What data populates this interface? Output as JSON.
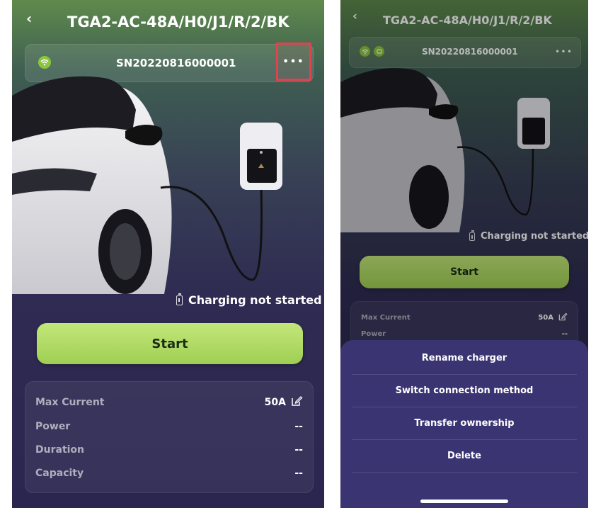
{
  "left": {
    "title": "TGA2-AC-48A/H0/J1/R/2/BK",
    "serial": "SN20220816000001",
    "more_label": "•••",
    "status": "Charging not started",
    "start_label": "Start",
    "stats": [
      {
        "label": "Max Current",
        "value": "50A"
      },
      {
        "label": "Power",
        "value": "--"
      },
      {
        "label": "Duration",
        "value": "--"
      },
      {
        "label": "Capacity",
        "value": "--"
      }
    ]
  },
  "right": {
    "title": "TGA2-AC-48A/H0/J1/R/2/BK",
    "serial": "SN20220816000001",
    "more_label": "•••",
    "status": "Charging not started",
    "start_label": "Start",
    "stats": [
      {
        "label": "Max Current",
        "value": "50A"
      },
      {
        "label": "Power",
        "value": "--"
      }
    ],
    "menu": [
      "Rename charger",
      "Switch connection method",
      "Transfer ownership",
      "Delete"
    ]
  },
  "icons": {
    "back": "chevron-left-icon",
    "wifi": "wifi-icon",
    "bluetooth": "bluetooth-icon",
    "battery": "battery-icon",
    "edit": "edit-icon",
    "more": "more-horizontal-icon"
  },
  "colors": {
    "accent_green": "#a8d85f",
    "highlight_red": "#e0434f",
    "sheet_bg": "#3b3472"
  }
}
